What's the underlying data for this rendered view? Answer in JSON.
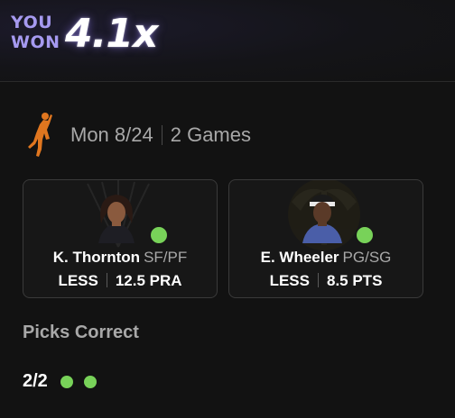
{
  "header": {
    "you_label": "YOU",
    "won_label": "WON",
    "multiplier": "4.1x"
  },
  "game": {
    "league_icon": "wnba-logo-icon",
    "date": "Mon 8/24",
    "count": "2 Games"
  },
  "picks": [
    {
      "name": "K. Thornton",
      "position": "SF/PF",
      "direction": "LESS",
      "line": "12.5",
      "stat": "PRA",
      "result": "correct",
      "line_text": "12.5 PRA"
    },
    {
      "name": "E. Wheeler",
      "position": "PG/SG",
      "direction": "LESS",
      "line": "8.5",
      "stat": "PTS",
      "result": "correct",
      "line_text": "8.5 PTS"
    }
  ],
  "summary": {
    "title": "Picks Correct",
    "count": "2/2",
    "results": [
      "correct",
      "correct"
    ]
  },
  "colors": {
    "accent_purple": "#a69af0",
    "success_green": "#78d259",
    "logo_orange": "#e0761f",
    "background": "#121212"
  }
}
